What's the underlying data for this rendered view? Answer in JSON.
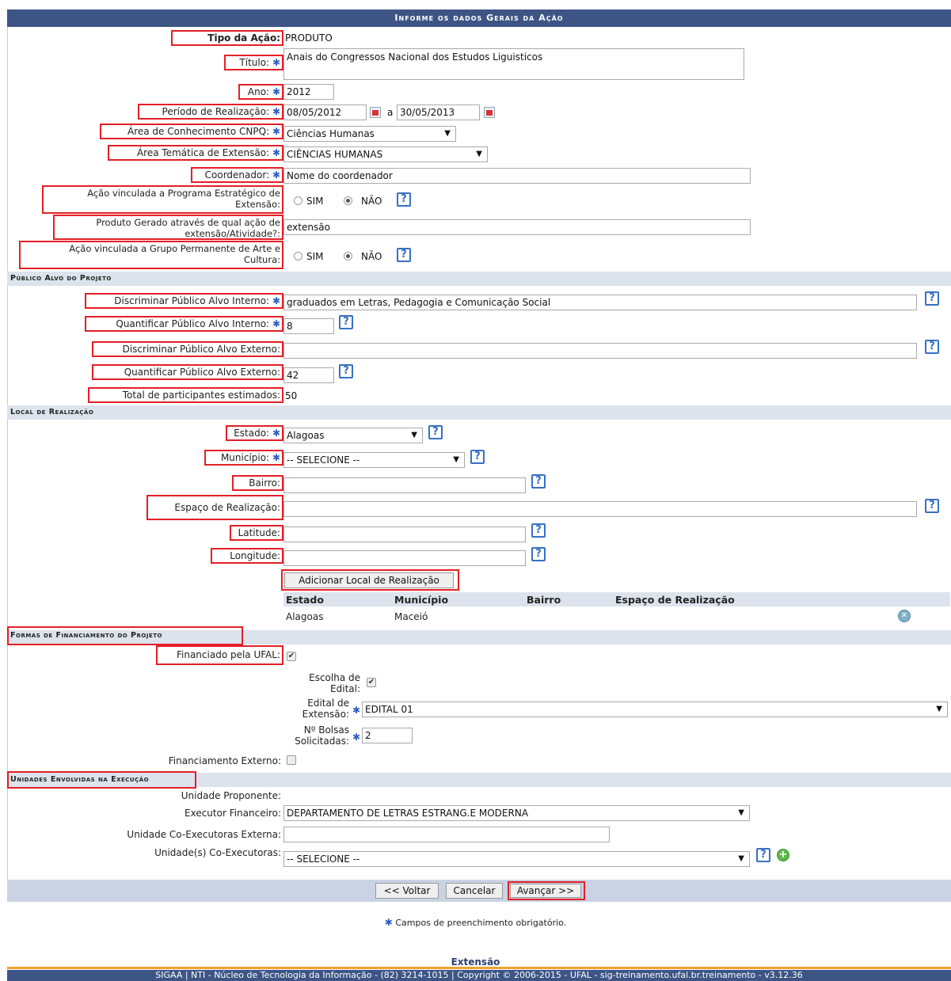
{
  "header": {
    "title": "Informe os dados Gerais da Ação"
  },
  "general": {
    "tipo_label": "Tipo da Ação:",
    "tipo_value": "PRODUTO",
    "titulo_label": "Título:",
    "titulo_value": "Anais do Congressos Nacional dos Estudos Liguisticos",
    "ano_label": "Ano:",
    "ano_value": "2012",
    "periodo_label": "Período de Realização:",
    "periodo_start": "08/05/2012",
    "periodo_sep": "a",
    "periodo_end": "30/05/2013",
    "area_cnpq_label": "Área de Conhecimento CNPQ:",
    "area_cnpq_value": "Ciências Humanas",
    "area_tematica_label": "Área Temática de Extensão:",
    "area_tematica_value": "CIÊNCIAS HUMANAS",
    "coordenador_label": "Coordenador:",
    "coordenador_value": "Nome do coordenador",
    "programa_label_1": "Ação vinculada a Programa Estratégico de",
    "programa_label_2": "Extensão:",
    "sim": "SIM",
    "nao": "NÃO",
    "produto_label_1": "Produto Gerado através de qual ação de",
    "produto_label_2": "extensão/Atividade?:",
    "produto_value": "extensão",
    "grupo_label_1": "Ação vinculada a Grupo Permanente de Arte e",
    "grupo_label_2": "Cultura:"
  },
  "publico": {
    "section": "Público Alvo do Projeto",
    "disc_interno_label": "Discriminar Público Alvo Interno:",
    "disc_interno_value": "graduados em Letras, Pedagogia e Comunicação Social",
    "quant_interno_label": "Quantificar Público Alvo Interno:",
    "quant_interno_value": "8",
    "disc_externo_label": "Discriminar Público Alvo Externo:",
    "disc_externo_value": "",
    "quant_externo_label": "Quantificar Público Alvo Externo:",
    "quant_externo_value": "42",
    "total_label": "Total de participantes estimados:",
    "total_value": "50"
  },
  "local": {
    "section": "Local de Realização",
    "estado_label": "Estado:",
    "estado_value": "Alagoas",
    "municipio_label": "Município:",
    "municipio_value": "-- SELECIONE --",
    "bairro_label": "Bairro:",
    "espaco_label": "Espaço de Realização:",
    "latitude_label": "Latitude:",
    "longitude_label": "Longitude:",
    "add_button": "Adicionar Local de Realização",
    "table_headers": [
      "Estado",
      "Município",
      "Bairro",
      "Espaço de Realização"
    ],
    "table_row": [
      "Alagoas",
      "Maceió",
      "",
      ""
    ]
  },
  "financiamento": {
    "section": "Formas de Financiamento do Projeto",
    "ufal_label": "Financiado pela UFAL:",
    "escolha_label_1": "Escolha de",
    "escolha_label_2": "Edital:",
    "edital_label_1": "Edital de",
    "edital_label_2": "Extensão:",
    "edital_value": "EDITAL 01",
    "bolsas_label_1": "Nº Bolsas",
    "bolsas_label_2": "Solicitadas:",
    "bolsas_value": "2",
    "externo_label": "Financiamento Externo:"
  },
  "unidades": {
    "section": "Unidades Envolvidas na Execução",
    "proponente_label": "Unidade Proponente:",
    "executor_label": "Executor Financeiro:",
    "executor_value": "DEPARTAMENTO DE LETRAS ESTRANG.E MODERNA",
    "coexternas_label": "Unidade Co-Executoras Externa:",
    "coexec_label": "Unidade(s) Co-Executoras:",
    "coexec_value": "-- SELECIONE --"
  },
  "actions": {
    "voltar": "<< Voltar",
    "cancelar": "Cancelar",
    "avancar": "Avançar >>"
  },
  "note": "Campos de preenchimento obrigatório.",
  "footer": {
    "module": "Extensão",
    "text": "SIGAA | NTI - Núcleo de Tecnologia da Informação - (82) 3214-1015 | Copyright © 2006-2015 - UFAL - sig-treinamento.ufal.br.treinamento - v3.12.36"
  },
  "colors": {
    "header_bg": "#3d5585",
    "section_bg": "#dde3ec",
    "highlight": "#e41f26",
    "required_star": "#2f5fc4"
  }
}
